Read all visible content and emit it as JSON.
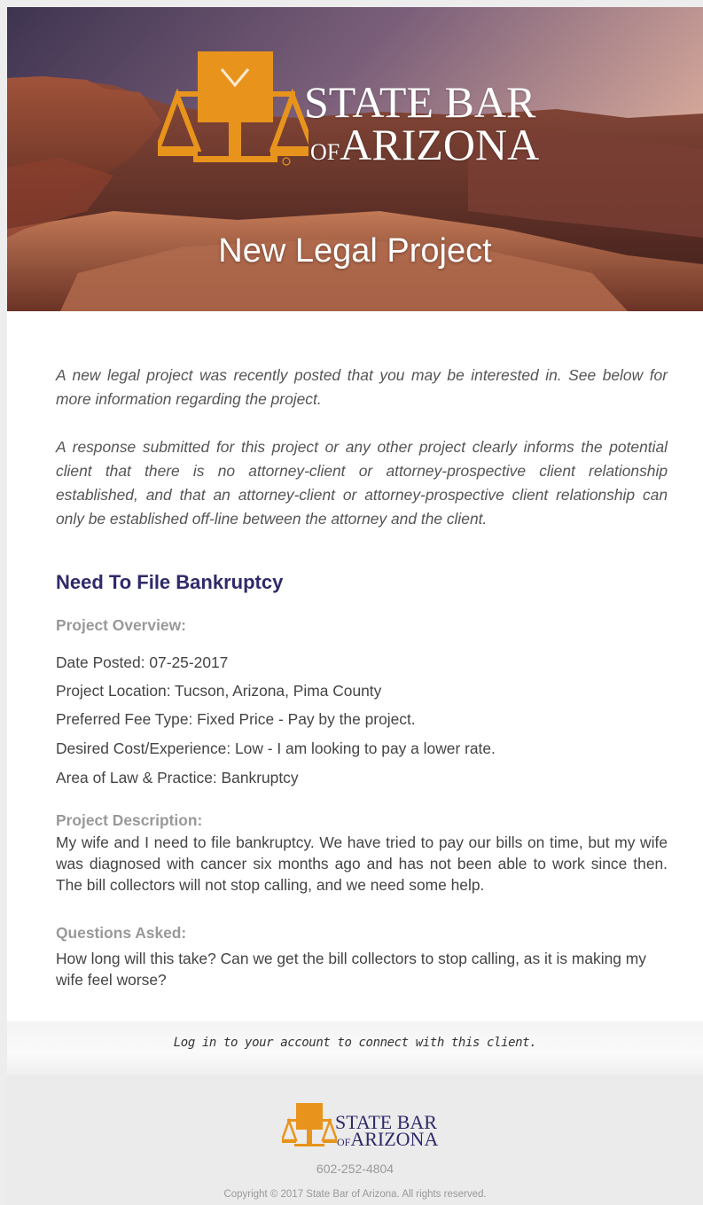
{
  "header": {
    "logo_line1": "STATE BAR",
    "logo_of": "OF",
    "logo_line2": "ARIZONA",
    "title": "New Legal Project"
  },
  "intro": {
    "p1": "A new legal project was recently posted that you may be interested in. See below for more information regarding the project.",
    "p2": "A response submitted for this project or any other project clearly informs the potential client that there is no attorney-client or attorney-prospective client relationship established, and that an attorney-client or attorney-prospective client relationship can only be established off-line between the attorney and the client."
  },
  "project": {
    "title": "Need To File Bankruptcy",
    "overview_label": "Project Overview:",
    "overview": [
      "Date Posted: 07-25-2017",
      "Project Location: Tucson, Arizona, Pima County",
      "Preferred Fee Type: Fixed Price - Pay by the project.",
      "Desired Cost/Experience: Low - I am looking to pay a lower rate.",
      "Area of Law & Practice: Bankruptcy"
    ],
    "description_label": "Project Description:",
    "description": "My wife and I need to file bankruptcy. We have tried to pay our bills on time, but my wife was diagnosed with cancer six months ago and has not been able to work since then. The bill collectors will not stop calling, and we need some help.",
    "questions_label": "Questions Asked:",
    "questions": "How long will this take? Can we get the bill collectors to stop calling, as it is making my wife feel worse?"
  },
  "cta": {
    "text": "Log in to your account to connect with this client."
  },
  "footer": {
    "logo_line1": "STATE BAR",
    "logo_of": "OF",
    "logo_line2": "ARIZONA",
    "phone": "602-252-4804",
    "copyright": "Copyright © 2017 State Bar of Arizona. All rights reserved."
  },
  "colors": {
    "brand_orange": "#e8941c",
    "title_navy": "#2f2a6a"
  },
  "icons": {
    "logo": "scales-of-justice-icon"
  }
}
